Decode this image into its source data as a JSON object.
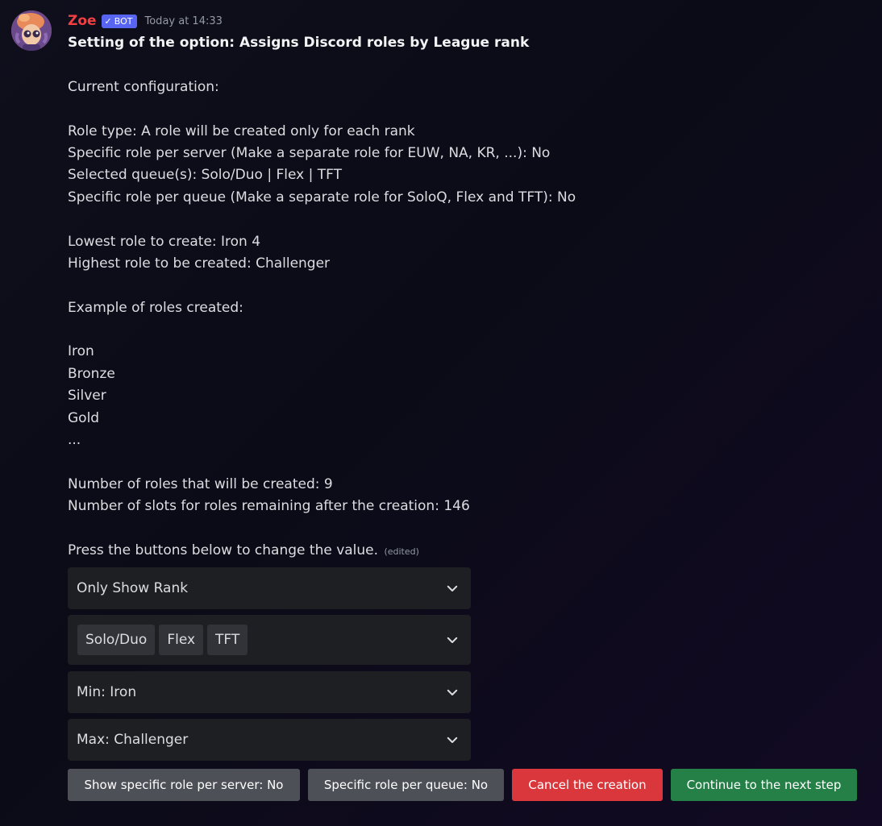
{
  "author": {
    "name": "Zoe",
    "bot_tag": "BOT",
    "timestamp": "Today at 14:33"
  },
  "message": {
    "lines": [
      "Setting of the option: Assigns Discord roles by League rank",
      "",
      "Current configuration:",
      "",
      "Role type: A role will be created only for each rank",
      "Specific role per server (Make a separate role for EUW, NA, KR, ...): No",
      "Selected queue(s): Solo/Duo | Flex | TFT",
      "Specific role per queue (Make a separate role for SoloQ, Flex and TFT): No",
      "",
      "Lowest role to create: Iron 4",
      "Highest role to be created: Challenger",
      "",
      "Example of roles created:",
      "",
      "Iron",
      "Bronze",
      "Silver",
      "Gold",
      "...",
      "",
      "Number of roles that will be created: 9",
      "Number of slots for roles remaining after the creation: 146",
      "",
      "Press the buttons below to change the value."
    ],
    "edited": "(edited)"
  },
  "selects": {
    "role_type": "Only Show Rank",
    "queues": [
      "Solo/Duo",
      "Flex",
      "TFT"
    ],
    "min": "Min: Iron",
    "max": "Max: Challenger"
  },
  "buttons": {
    "per_server": "Show specific role per server: No",
    "per_queue": "Specific role per queue: No",
    "cancel": "Cancel the creation",
    "continue": "Continue to the next step"
  },
  "colors": {
    "username": "#f23f42",
    "bot_tag": "#5865f2",
    "button_grey": "#4e5058",
    "button_red": "#da373c",
    "button_green": "#248046",
    "select_bg": "#1e1f22"
  }
}
